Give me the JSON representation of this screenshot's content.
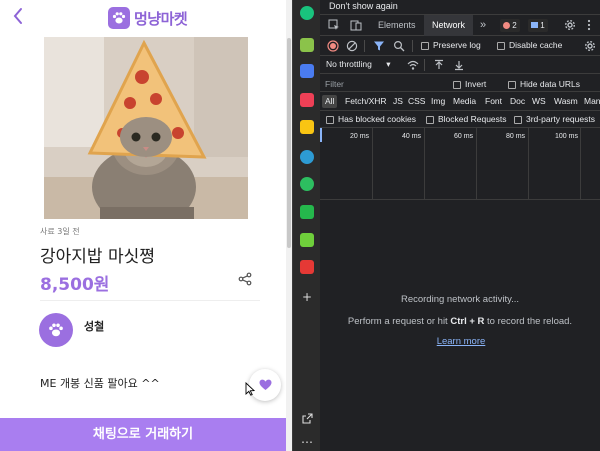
{
  "app": {
    "back_glyph": "‹",
    "logo_text": "멍냥마켓",
    "meta": "사료 3일 전",
    "title": "강아지밥 마싯쪙",
    "price": "8,500원",
    "seller_name": "성철",
    "description": "ME 개봉 신품 팔아요 ^^",
    "chat_button_label": "채팅으로 거래하기",
    "accent_color": "#9b6fe0"
  },
  "browser_sidebar": {
    "icons": [
      "chatgpt-icon",
      "memo-icon",
      "calendar-icon",
      "pocket-icon",
      "favorites-icon",
      "edge-icon",
      "evernote-icon",
      "youtube-music-icon",
      "memo-green-icon",
      "wavve-icon"
    ],
    "add_label": "+",
    "more_label": "…"
  },
  "devtools": {
    "dont_show_again": "Don't show again",
    "tabs": [
      "Elements",
      "Network"
    ],
    "more_tabs": "»",
    "error_count": "2",
    "message_count": "1",
    "preserve_log": "Preserve log",
    "disable_cache": "Disable cache",
    "throttling": "No throttling",
    "filter_placeholder": "Filter",
    "invert": "Invert",
    "hide_data_urls": "Hide data URLs",
    "types": [
      "All",
      "Fetch/XHR",
      "JS",
      "CSS",
      "Img",
      "Media",
      "Font",
      "Doc",
      "WS",
      "Wasm",
      "Man"
    ],
    "has_blocked_cookies": "Has blocked cookies",
    "blocked_requests": "Blocked Requests",
    "third_party": "3rd-party requests",
    "ticks": [
      "20 ms",
      "40 ms",
      "60 ms",
      "80 ms",
      "100 ms"
    ],
    "recording": "Recording network activity...",
    "hint_prefix": "Perform a request or hit ",
    "hint_shortcut": "Ctrl + R",
    "hint_suffix": " to record the reload.",
    "learn_more": "Learn more"
  }
}
